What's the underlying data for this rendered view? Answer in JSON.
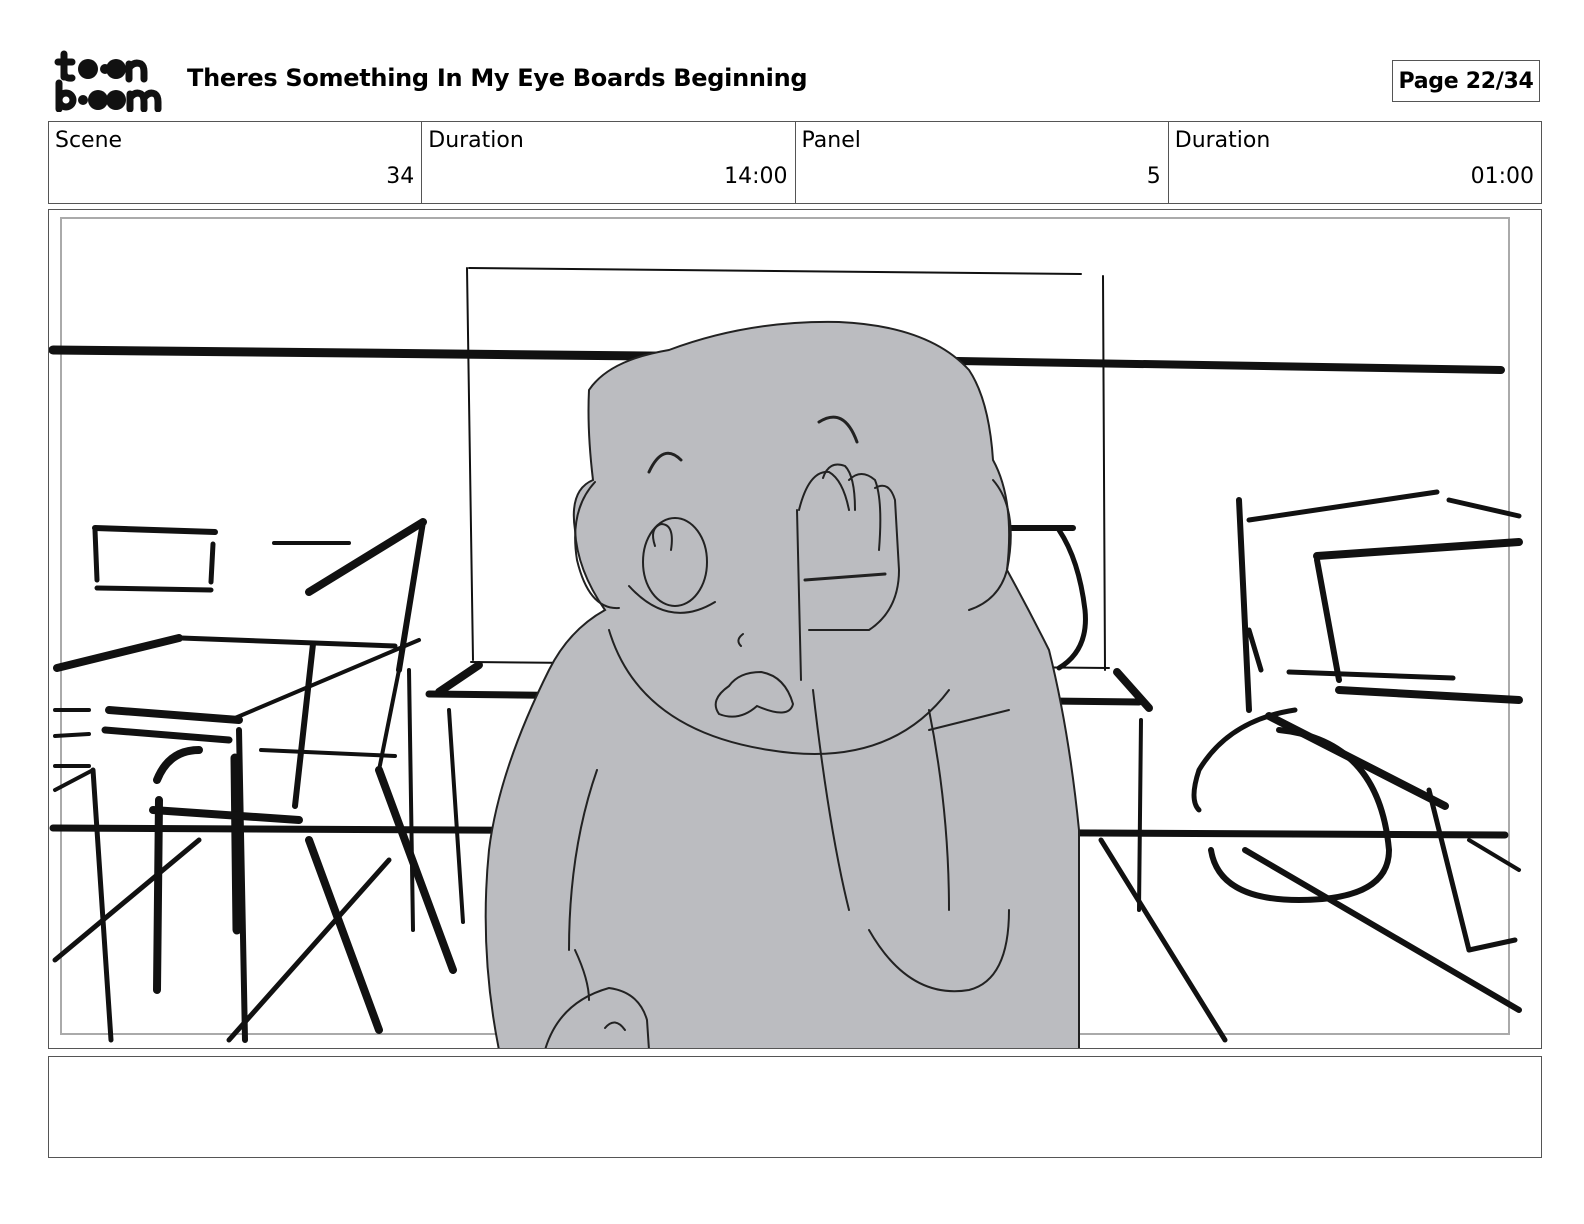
{
  "header": {
    "logo_text_top": "toon",
    "logo_text_bottom": "boom",
    "title": "Theres Something In My Eye Boards Beginning",
    "page": "Page 22/34"
  },
  "info": {
    "scene_label": "Scene",
    "scene_value": "34",
    "scene_duration_label": "Duration",
    "scene_duration_value": "14:00",
    "panel_label": "Panel",
    "panel_value": "5",
    "panel_duration_label": "Duration",
    "panel_duration_value": "01:00"
  },
  "panel": {
    "image": "storyboard-sketch-classroom-character-rubbing-eye",
    "character_fill": "#bbbcc0"
  },
  "notes": {
    "text": ""
  }
}
